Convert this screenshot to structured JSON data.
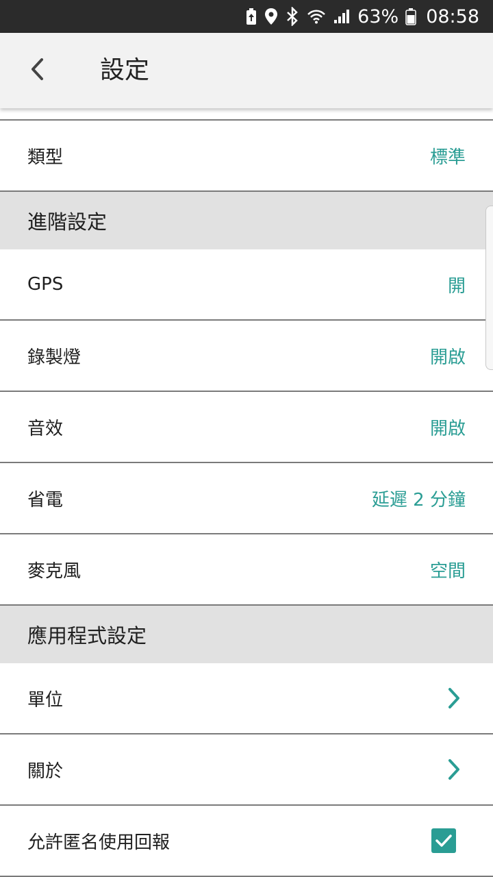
{
  "status_bar": {
    "battery_percent": "63%",
    "time": "08:58",
    "icons": [
      "battery-saver-icon",
      "location-icon",
      "bluetooth-icon",
      "wifi-icon",
      "signal-icon",
      "battery-icon"
    ]
  },
  "header": {
    "title": "設定",
    "back_icon": "chevron-left-icon"
  },
  "colors": {
    "accent": "#2a9d94",
    "section_bg": "#e1e1e1",
    "app_bar_bg": "#f2f2f2",
    "status_bar_bg": "#2b2b2b"
  },
  "settings": {
    "type": {
      "label": "類型",
      "value": "標準"
    },
    "advanced_header": "進階設定",
    "gps": {
      "label": "GPS",
      "value": "開"
    },
    "record_light": {
      "label": "錄製燈",
      "value": "開啟"
    },
    "sound": {
      "label": "音效",
      "value": "開啟"
    },
    "power_saving": {
      "label": "省電",
      "value": "延遲 2 分鐘"
    },
    "microphone": {
      "label": "麥克風",
      "value": "空間"
    },
    "app_header": "應用程式設定",
    "units": {
      "label": "單位",
      "icon": "chevron-right-icon"
    },
    "about": {
      "label": "關於",
      "icon": "chevron-right-icon"
    },
    "anonymous_report": {
      "label": "允許匿名使用回報",
      "checked": true
    }
  }
}
